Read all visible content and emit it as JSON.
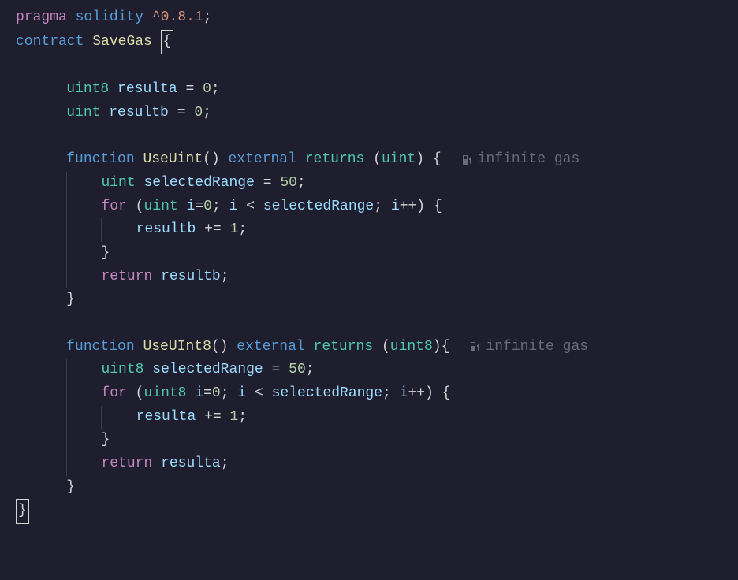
{
  "code": {
    "l1": {
      "pragma": "pragma",
      "solidity": "solidity",
      "version": "^0.8.1",
      "semi": ";"
    },
    "l2": {
      "contract": "contract",
      "name": "SaveGas",
      "brace": "{"
    },
    "l4": {
      "type": "uint8",
      "var": "resulta",
      "eq": "=",
      "val": "0",
      "semi": ";"
    },
    "l5": {
      "type": "uint",
      "var": "resultb",
      "eq": "=",
      "val": "0",
      "semi": ";"
    },
    "l7": {
      "func": "function",
      "name": "UseUint",
      "parens": "()",
      "external": "external",
      "returns": "returns",
      "rparen_open": "(",
      "rtype": "uint",
      "rparen_close": ")",
      "brace": "{"
    },
    "l8": {
      "type": "uint",
      "var": "selectedRange",
      "eq": "=",
      "val": "50",
      "semi": ";"
    },
    "l9": {
      "for": "for",
      "open": "(",
      "type": "uint",
      "ivar": "i",
      "eq": "=",
      "zero": "0",
      "semi1": ";",
      "ivar2": "i",
      "lt": "<",
      "range": "selectedRange",
      "semi2": ";",
      "ivar3": "i",
      "inc": "++",
      "close": ")",
      "brace": "{"
    },
    "l10": {
      "var": "resultb",
      "op": "+=",
      "val": "1",
      "semi": ";"
    },
    "l11": {
      "brace": "}"
    },
    "l12": {
      "return": "return",
      "var": "resultb",
      "semi": ";"
    },
    "l13": {
      "brace": "}"
    },
    "l15": {
      "func": "function",
      "name": "UseUInt8",
      "parens": "()",
      "external": "external",
      "returns": "returns",
      "rparen_open": "(",
      "rtype": "uint8",
      "rparen_close": ")",
      "brace": "{"
    },
    "l16": {
      "type": "uint8",
      "var": "selectedRange",
      "eq": "=",
      "val": "50",
      "semi": ";"
    },
    "l17": {
      "for": "for",
      "open": "(",
      "type": "uint8",
      "ivar": "i",
      "eq": "=",
      "zero": "0",
      "semi1": ";",
      "ivar2": "i",
      "lt": "<",
      "range": "selectedRange",
      "semi2": ";",
      "ivar3": "i",
      "inc": "++",
      "close": ")",
      "brace": "{"
    },
    "l18": {
      "var": "resulta",
      "op": "+=",
      "val": "1",
      "semi": ";"
    },
    "l19": {
      "brace": "}"
    },
    "l20": {
      "return": "return",
      "var": "resulta",
      "semi": ";"
    },
    "l21": {
      "brace": "}"
    },
    "l22": {
      "brace": "}"
    }
  },
  "hints": {
    "gas1": "infinite gas",
    "gas2": "infinite gas"
  }
}
